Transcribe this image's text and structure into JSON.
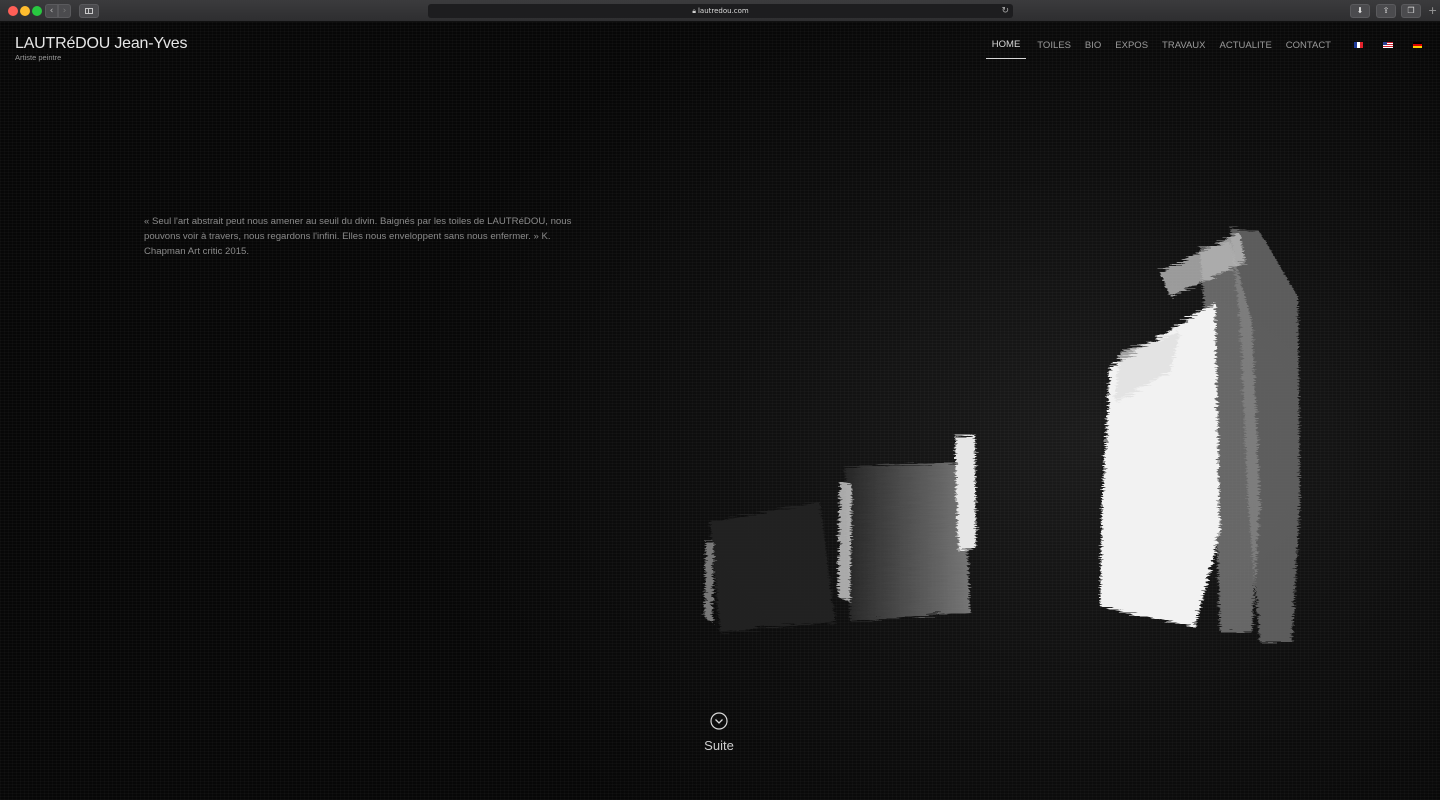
{
  "browser": {
    "url": "lautredou.com"
  },
  "site": {
    "title": "LAUTRéDOU Jean-Yves",
    "subtitle": "Artiste peintre"
  },
  "nav": {
    "items": [
      {
        "label": "HOME",
        "active": true
      },
      {
        "label": "TOILES",
        "active": false
      },
      {
        "label": "BIO",
        "active": false
      },
      {
        "label": "EXPOS",
        "active": false
      },
      {
        "label": "TRAVAUX",
        "active": false
      },
      {
        "label": "ACTUALITE",
        "active": false
      },
      {
        "label": "CONTACT",
        "active": false
      }
    ],
    "flags": [
      "flag-fr-icon",
      "flag-us-icon",
      "flag-de-icon"
    ]
  },
  "hero": {
    "quote": "« Seul l'art abstrait peut nous amener au seuil du divin. Baignés par les toiles de LAUTRéDOU, nous pouvons voir à travers, nous regardons l'infini. Elles nous enveloppent sans nous enfermer. » K. Chapman Art critic 2015.",
    "cta_label": "Suite"
  },
  "colors": {
    "background": "#000000",
    "text": "#e6e6e6",
    "muted": "#8a8a8a"
  }
}
